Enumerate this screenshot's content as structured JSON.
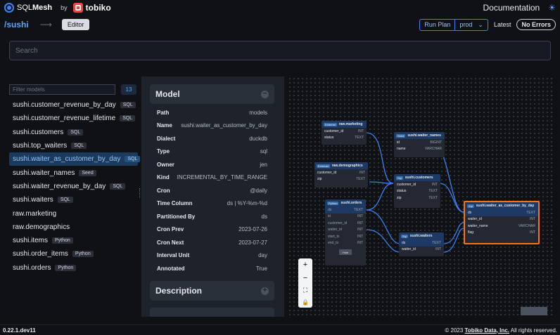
{
  "header": {
    "logo_text_a": "SQL",
    "logo_text_b": "Mesh",
    "by": "by",
    "tobiko": "tobiko",
    "documentation": "Documentation"
  },
  "subheader": {
    "project": "/sushi",
    "editor": "Editor",
    "run_plan": "Run Plan",
    "env": "prod",
    "latest": "Latest",
    "errors": "No Errors"
  },
  "search": {
    "placeholder": "Search"
  },
  "sidebar": {
    "filter_placeholder": "Filter models",
    "count": "13",
    "models": [
      {
        "name": "sushi.customer_revenue_by_day",
        "tag": "SQL"
      },
      {
        "name": "sushi.customer_revenue_lifetime",
        "tag": "SQL"
      },
      {
        "name": "sushi.customers",
        "tag": "SQL"
      },
      {
        "name": "sushi.top_waiters",
        "tag": "SQL"
      },
      {
        "name": "sushi.waiter_as_customer_by_day",
        "tag": "SQL",
        "active": true
      },
      {
        "name": "sushi.waiter_names",
        "tag": "Seed"
      },
      {
        "name": "sushi.waiter_revenue_by_day",
        "tag": "SQL"
      },
      {
        "name": "sushi.waiters",
        "tag": "SQL"
      },
      {
        "name": "raw.marketing",
        "tag": ""
      },
      {
        "name": "raw.demographics",
        "tag": ""
      },
      {
        "name": "sushi.items",
        "tag": "Python"
      },
      {
        "name": "sushi.order_items",
        "tag": "Python"
      },
      {
        "name": "sushi.orders",
        "tag": "Python"
      }
    ]
  },
  "details": {
    "model_title": "Model",
    "description_title": "Description",
    "props": [
      {
        "k": "Path",
        "v": "models"
      },
      {
        "k": "Name",
        "v": "sushi.waiter_as_customer_by_day"
      },
      {
        "k": "Dialect",
        "v": "duckdb"
      },
      {
        "k": "Type",
        "v": "sql"
      },
      {
        "k": "Owner",
        "v": "jen"
      },
      {
        "k": "Kind",
        "v": "INCREMENTAL_BY_TIME_RANGE"
      },
      {
        "k": "Cron",
        "v": "@daily"
      },
      {
        "k": "Time Column",
        "v": "ds | %Y-%m-%d"
      },
      {
        "k": "Partitioned By",
        "v": "ds"
      },
      {
        "k": "Cron Prev",
        "v": "2023-07-26"
      },
      {
        "k": "Cron Next",
        "v": "2023-07-27"
      },
      {
        "k": "Interval Unit",
        "v": "day"
      },
      {
        "k": "Annotated",
        "v": "True"
      }
    ]
  },
  "graph": {
    "hide": "Hide",
    "nodes": {
      "marketing": {
        "tag": "External",
        "title": "raw.marketing",
        "cols": [
          {
            "n": "customer_id",
            "t": "INT"
          },
          {
            "n": "status",
            "t": "TEXT"
          }
        ]
      },
      "demographics": {
        "tag": "External",
        "title": "raw.demographics",
        "cols": [
          {
            "n": "customer_id",
            "t": "INT"
          },
          {
            "n": "zip",
            "t": "TEXT"
          }
        ]
      },
      "orders": {
        "tag": "Python",
        "title": "sushi.orders",
        "cols": [
          {
            "n": "ds",
            "t": "TEXT"
          },
          {
            "n": "id",
            "t": "INT"
          },
          {
            "n": "customer_id",
            "t": "INT"
          },
          {
            "n": "waiter_id",
            "t": "INT"
          },
          {
            "n": "start_ts",
            "t": "INT"
          },
          {
            "n": "end_ts",
            "t": "INT"
          }
        ]
      },
      "waiter_names": {
        "tag": "Seed",
        "title": "sushi.waiter_names",
        "cols": [
          {
            "n": "id",
            "t": "BIGINT"
          },
          {
            "n": "name",
            "t": "VARCHAR"
          }
        ]
      },
      "customers": {
        "tag": "Sql",
        "title": "sushi.customers",
        "cols": [
          {
            "n": "customer_id",
            "t": "INT"
          },
          {
            "n": "status",
            "t": "TEXT"
          },
          {
            "n": "zip",
            "t": "TEXT"
          }
        ]
      },
      "waiters": {
        "tag": "Sql",
        "title": "sushi.waiters",
        "cols": [
          {
            "n": "ds",
            "t": "TEXT"
          },
          {
            "n": "waiter_id",
            "t": "INT"
          }
        ]
      },
      "focus": {
        "tag": "Sql",
        "title": "sushi.waiter_as_customer_by_day",
        "cols": [
          {
            "n": "ds",
            "t": "TEXT"
          },
          {
            "n": "waiter_id",
            "t": "INT"
          },
          {
            "n": "waiter_name",
            "t": "VARCHAR"
          },
          {
            "n": "flag",
            "t": "INT"
          }
        ]
      }
    },
    "zoom": {
      "plus": "+",
      "minus": "−",
      "fit": "⛶",
      "lock": "🔒"
    },
    "edge_color": "#3b82f6"
  },
  "footer": {
    "version": "0.22.1.dev11",
    "copyright_prefix": "© 2023",
    "company": "Tobiko Data, Inc.",
    "rights": "All rights reserved."
  }
}
